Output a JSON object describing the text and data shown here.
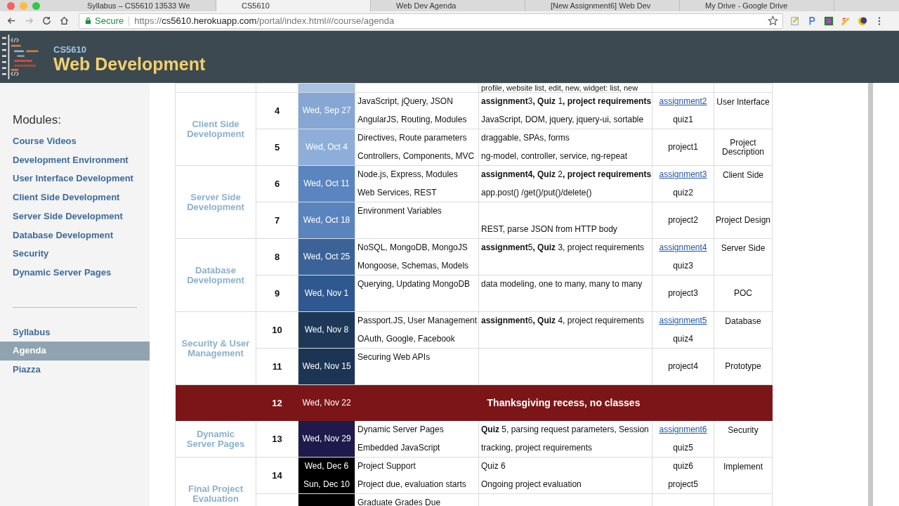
{
  "browser": {
    "tabs": [
      {
        "title": "Syllabus – CS5610 13533 We",
        "selected": false
      },
      {
        "title": "CS5610",
        "selected": true
      },
      {
        "title": "Web Dev Agenda",
        "selected": false
      },
      {
        "title": "[New Assignment6] Web Dev",
        "selected": false
      },
      {
        "title": "My Drive - Google Drive",
        "selected": false
      }
    ],
    "secure_label": "Secure",
    "url": {
      "scheme": "https://",
      "host": "cs5610.herokuapp.com",
      "path": "/portal/index.html#/course/agenda"
    }
  },
  "header": {
    "course": "CS5610",
    "title": "Web Development"
  },
  "sidebar": {
    "heading": "Modules:",
    "modules": [
      "Course Videos",
      "Development Environment",
      "User Interface Development",
      "Client Side Development",
      "Server Side Development",
      "Database Development",
      "Security",
      "Dynamic Server Pages"
    ],
    "links": [
      {
        "label": "Syllabus",
        "selected": false
      },
      {
        "label": "Agenda",
        "selected": true
      },
      {
        "label": "Piazza",
        "selected": false
      }
    ]
  },
  "agenda": {
    "top_row": {
      "content": "profile, website list, edit, new, widget: list, new",
      "color": "#a9c3e0"
    },
    "groups": [
      {
        "module": "Client Side Development",
        "rows": [
          {
            "kind": "lecture",
            "week": "4",
            "dates": [
              "Wed, Sep 27"
            ],
            "color": "#86a7d4",
            "lines": [
              {
                "topic": "JavaScript, jQuery, JSON",
                "content": "**assignment**3**, Quiz** 1**, project requirements**"
              },
              {
                "topic": "AngularJS, Routing, Modules",
                "content": "JavaScript, DOM, jquery, jquery-ui, sortable"
              }
            ],
            "due": [
              {
                "kind": "link",
                "text": "assignment2"
              },
              {
                "kind": "text",
                "text": "quiz1"
              }
            ],
            "phase": "User Interface"
          },
          {
            "kind": "lecture",
            "week": "5",
            "dates": [
              "Wed, Oct 4"
            ],
            "color": "#8eaed9",
            "lines": [
              {
                "topic": "Directives, Route parameters",
                "content": "draggable, SPAs, forms"
              },
              {
                "topic": "Controllers, Components, MVC",
                "content": "ng-model, controller, service, ng-repeat"
              }
            ],
            "due": [
              {
                "kind": "text",
                "text": "project1"
              }
            ],
            "phase": "Project Description"
          }
        ]
      },
      {
        "module": "Server Side Development",
        "rows": [
          {
            "kind": "lecture",
            "week": "6",
            "dates": [
              "Wed, Oct 11"
            ],
            "color": "#5b85bf",
            "lines": [
              {
                "topic": "Node.js, Express, Modules",
                "content": "**assignment4, Quiz** 2**, project requirements**"
              },
              {
                "topic": "Web Services, REST",
                "content": "app.post() /get()/put()/delete()"
              }
            ],
            "due": [
              {
                "kind": "link",
                "text": "assignment3"
              },
              {
                "kind": "text",
                "text": "quiz2"
              }
            ],
            "phase": "Client Side"
          },
          {
            "kind": "lecture",
            "week": "7",
            "dates": [
              "Wed, Oct 18"
            ],
            "color": "#5984be",
            "lines": [
              {
                "topic": "Environment Variables"
              },
              {
                "content": "REST, parse JSON from HTTP body"
              }
            ],
            "due": [
              {
                "kind": "text",
                "text": "project2"
              }
            ],
            "phase": "Project Design"
          }
        ]
      },
      {
        "module": "Database Development",
        "rows": [
          {
            "kind": "lecture",
            "week": "8",
            "dates": [
              "Wed, Oct 25"
            ],
            "color": "#3c6398",
            "lines": [
              {
                "topic": "NoSQL, MongoDB, MongoJS",
                "content": "**assignment**5**, Quiz** 3, project requirements"
              },
              {
                "topic": "Mongoose, Schemas, Models"
              }
            ],
            "due": [
              {
                "kind": "link",
                "text": "assignment4"
              },
              {
                "kind": "text",
                "text": "quiz3"
              }
            ],
            "phase": "Server Side"
          },
          {
            "kind": "lecture",
            "week": "9",
            "dates": [
              "Wed, Nov 1"
            ],
            "color": "#2f5890",
            "lines": [
              {
                "topic": "Querying, Updating MongoDB",
                "content": "data modeling, one to many, many to many"
              }
            ],
            "due": [
              {
                "kind": "text",
                "text": "project3"
              }
            ],
            "phase": "POC"
          }
        ]
      },
      {
        "module": "Security & User Management",
        "rows": [
          {
            "kind": "lecture",
            "week": "10",
            "dates": [
              "Wed, Nov 8"
            ],
            "color": "#1e3858",
            "lines": [
              {
                "topic": "Passport.JS, User Management",
                "content": "**assignment**6**, Quiz** 4, project requirements"
              },
              {
                "topic": "OAuth, Google, Facebook"
              }
            ],
            "due": [
              {
                "kind": "link",
                "text": "assignment5"
              },
              {
                "kind": "text",
                "text": "quiz4"
              }
            ],
            "phase": "Database"
          },
          {
            "kind": "lecture",
            "week": "11",
            "dates": [
              "Wed, Nov 15"
            ],
            "color": "#1c3554",
            "lines": [
              {
                "topic": "Securing Web APIs"
              }
            ],
            "due": [
              {
                "kind": "text",
                "text": "project4"
              }
            ],
            "phase": "Prototype"
          }
        ]
      },
      {
        "rows": [
          {
            "kind": "holiday",
            "week": "12",
            "dates": [
              "Wed, Nov 22"
            ],
            "color": "#7c1517",
            "note": "Thanksgiving recess, no classes"
          }
        ]
      },
      {
        "module": "Dynamic Server Pages",
        "rows": [
          {
            "kind": "lecture",
            "week": "13",
            "dates": [
              "Wed, Nov 29"
            ],
            "color": "#1f1a4c",
            "lines": [
              {
                "topic": "Dynamic Server Pages",
                "content": "**Quiz** 5, parsing request parameters, Session"
              },
              {
                "topic": "Embedded JavaScript",
                "content": "tracking, project requirements"
              }
            ],
            "due": [
              {
                "kind": "link",
                "text": "assignment6"
              },
              {
                "kind": "text",
                "text": "quiz5"
              }
            ],
            "phase": "Security"
          }
        ]
      },
      {
        "module": "Final Project Evaluation",
        "rows": [
          {
            "kind": "lecture",
            "week": "14",
            "dates": [
              "Wed, Dec 6",
              "Sun, Dec 10"
            ],
            "color": "#000000",
            "lines": [
              {
                "topic": "Project Support",
                "content": "Quiz 6"
              },
              {
                "topic": "Project due, evaluation starts",
                "content": "Ongoing project evaluation"
              }
            ],
            "due": [
              {
                "kind": "text",
                "text": "quiz6"
              },
              {
                "kind": "text",
                "text": "project5"
              }
            ],
            "phase": "Implement"
          },
          {
            "kind": "lecture",
            "color": "#000000",
            "lines": [
              {
                "topic": "Graduate Grades Due"
              }
            ]
          }
        ]
      }
    ]
  }
}
